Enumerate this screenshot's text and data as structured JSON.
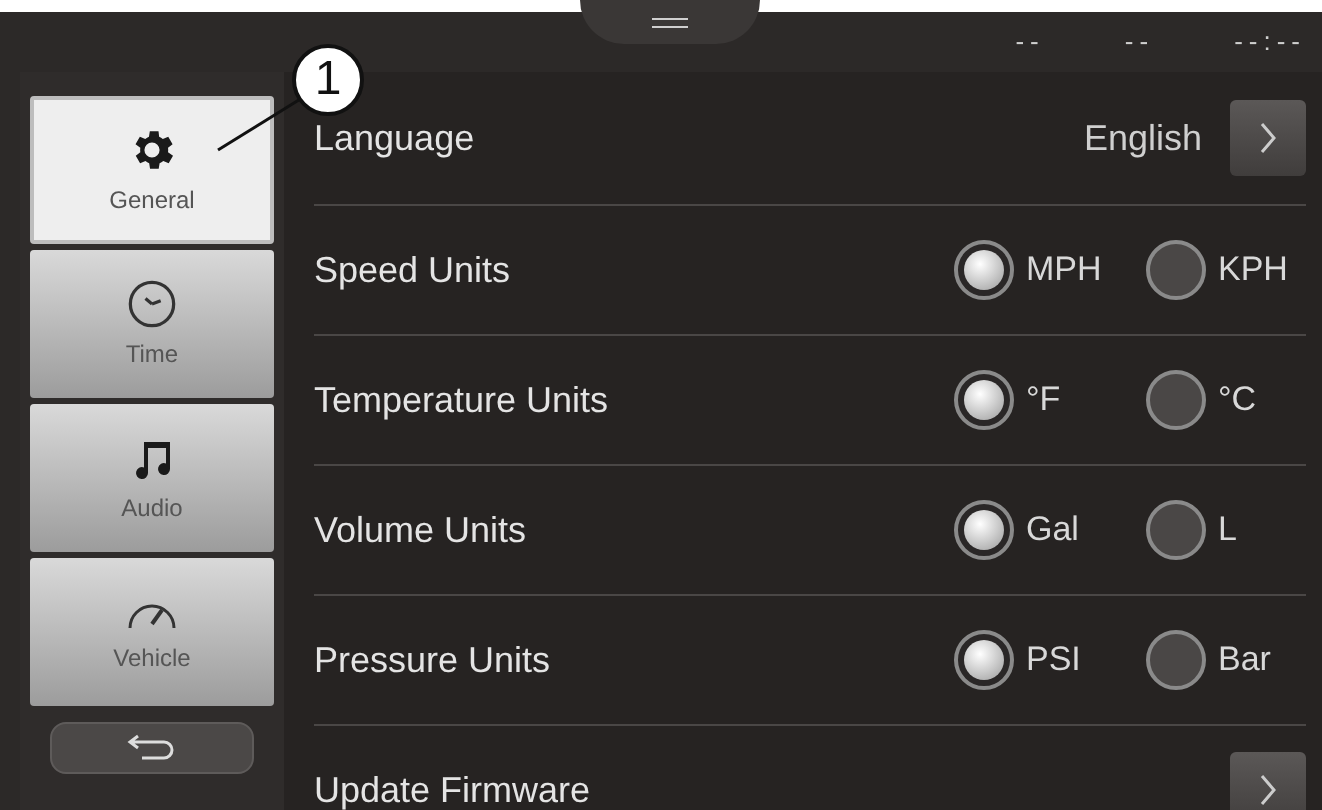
{
  "status_bar": {
    "fields": [
      "--",
      "--",
      "--:--"
    ]
  },
  "sidebar": {
    "items": [
      {
        "label": "General",
        "selected": true
      },
      {
        "label": "Time",
        "selected": false
      },
      {
        "label": "Audio",
        "selected": false
      },
      {
        "label": "Vehicle",
        "selected": false
      }
    ]
  },
  "settings": [
    {
      "kind": "link",
      "label": "Language",
      "value": "English"
    },
    {
      "kind": "radio",
      "label": "Speed Units",
      "options": [
        {
          "label": "MPH",
          "selected": true
        },
        {
          "label": "KPH",
          "selected": false
        }
      ]
    },
    {
      "kind": "radio",
      "label": "Temperature Units",
      "options": [
        {
          "label": "°F",
          "selected": true
        },
        {
          "label": "°C",
          "selected": false
        }
      ]
    },
    {
      "kind": "radio",
      "label": "Volume Units",
      "options": [
        {
          "label": "Gal",
          "selected": true
        },
        {
          "label": "L",
          "selected": false
        }
      ]
    },
    {
      "kind": "radio",
      "label": "Pressure Units",
      "options": [
        {
          "label": "PSI",
          "selected": true
        },
        {
          "label": "Bar",
          "selected": false
        }
      ]
    },
    {
      "kind": "link",
      "label": "Update Firmware"
    }
  ],
  "callout": {
    "label": "1"
  }
}
